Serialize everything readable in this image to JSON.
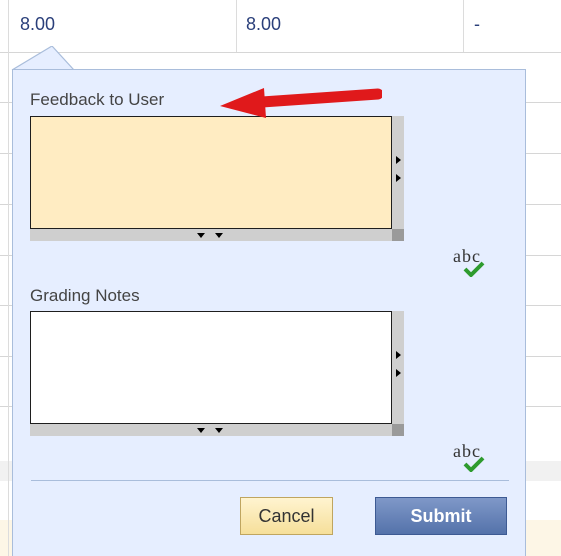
{
  "table": {
    "row1": [
      "8.00",
      "8.00",
      "-"
    ]
  },
  "popup": {
    "feedback_label": "Feedback to User",
    "feedback_value": "",
    "notes_label": "Grading Notes",
    "notes_value": "",
    "spell_icon_text": "abc",
    "cancel_label": "Cancel",
    "submit_label": "Submit"
  },
  "colors": {
    "feedback_bg": "#ffecc2",
    "popup_bg": "#e6eeff",
    "submit_bg": "#5472aa",
    "cancel_bg": "#f6df9a",
    "arrow": "#e0191b",
    "check": "#2e9b2e"
  },
  "icons": {
    "spellcheck": "spellcheck-icon",
    "annotation": "red-arrow-annotation"
  }
}
